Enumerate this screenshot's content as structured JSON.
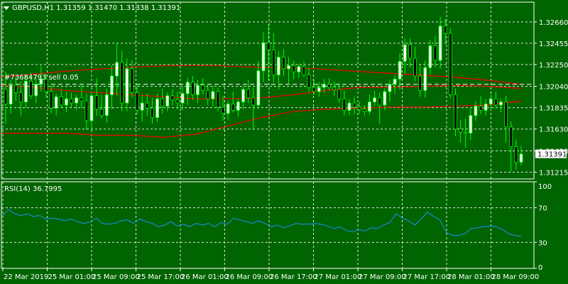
{
  "colors": {
    "background": "#006400",
    "grid": "#ffffff",
    "bull": "#ffffff",
    "bear": "#000000",
    "wick": "#00ff00",
    "ma": "#ff0000",
    "rsi": "#1e90ff",
    "axis_text": "#ffffff",
    "price_label_bg": "#ffffff",
    "price_label_text": "#000000"
  },
  "header": {
    "menu_icon": "triangle-down-icon",
    "text": "GBPUSD,H1  1.31359 1.31470 1.31338 1.31391"
  },
  "order_label": "#73684793 sell 0.05",
  "rsi_header": "RSI(14) 36.7995",
  "chart_data": [
    {
      "type": "candlestick",
      "symbol": "GBPUSD",
      "timeframe": "H1",
      "ylim": [
        1.3115,
        1.3285
      ],
      "y_ticks": [
        "1.32660",
        "1.32455",
        "1.32250",
        "1.32040",
        "1.31835",
        "1.31630",
        "1.31420",
        "1.31215"
      ],
      "current_price": "1.31391",
      "order_level": 1.3206,
      "x_ticks": [
        "22 Mar 2019",
        "25 Mar 01:00",
        "25 Mar 09:00",
        "25 Mar 17:00",
        "26 Mar 01:00",
        "26 Mar 09:00",
        "26 Mar 17:00",
        "27 Mar 01:00",
        "27 Mar 09:00",
        "27 Mar 17:00",
        "28 Mar 01:00",
        "28 Mar 09:00"
      ],
      "candles": [
        {
          "o": 1.3201,
          "h": 1.3218,
          "l": 1.3168,
          "c": 1.3187
        },
        {
          "o": 1.3187,
          "h": 1.321,
          "l": 1.3178,
          "c": 1.3205
        },
        {
          "o": 1.3205,
          "h": 1.3213,
          "l": 1.319,
          "c": 1.3198
        },
        {
          "o": 1.3198,
          "h": 1.3209,
          "l": 1.3176,
          "c": 1.3189
        },
        {
          "o": 1.3189,
          "h": 1.3215,
          "l": 1.3183,
          "c": 1.3209
        },
        {
          "o": 1.3209,
          "h": 1.3217,
          "l": 1.3192,
          "c": 1.3195
        },
        {
          "o": 1.3195,
          "h": 1.3212,
          "l": 1.3188,
          "c": 1.3206
        },
        {
          "o": 1.3206,
          "h": 1.3224,
          "l": 1.3199,
          "c": 1.3211
        },
        {
          "o": 1.3211,
          "h": 1.3216,
          "l": 1.3193,
          "c": 1.3199
        },
        {
          "o": 1.3199,
          "h": 1.3205,
          "l": 1.3178,
          "c": 1.3183
        },
        {
          "o": 1.3183,
          "h": 1.3197,
          "l": 1.3176,
          "c": 1.3194
        },
        {
          "o": 1.3194,
          "h": 1.3201,
          "l": 1.3183,
          "c": 1.3186
        },
        {
          "o": 1.3186,
          "h": 1.3199,
          "l": 1.3179,
          "c": 1.3192
        },
        {
          "o": 1.3192,
          "h": 1.3198,
          "l": 1.3184,
          "c": 1.3188
        },
        {
          "o": 1.3188,
          "h": 1.3196,
          "l": 1.3181,
          "c": 1.3193
        },
        {
          "o": 1.3193,
          "h": 1.3205,
          "l": 1.3183,
          "c": 1.319
        },
        {
          "o": 1.319,
          "h": 1.3197,
          "l": 1.3162,
          "c": 1.3171
        },
        {
          "o": 1.3171,
          "h": 1.3199,
          "l": 1.3162,
          "c": 1.3195
        },
        {
          "o": 1.3195,
          "h": 1.3212,
          "l": 1.3176,
          "c": 1.3182
        },
        {
          "o": 1.3182,
          "h": 1.3196,
          "l": 1.3173,
          "c": 1.3176
        },
        {
          "o": 1.3176,
          "h": 1.3202,
          "l": 1.3169,
          "c": 1.3196
        },
        {
          "o": 1.3196,
          "h": 1.3224,
          "l": 1.3182,
          "c": 1.3214
        },
        {
          "o": 1.3214,
          "h": 1.3246,
          "l": 1.3195,
          "c": 1.3227
        },
        {
          "o": 1.3227,
          "h": 1.3238,
          "l": 1.318,
          "c": 1.3188
        },
        {
          "o": 1.3188,
          "h": 1.3231,
          "l": 1.318,
          "c": 1.3221
        },
        {
          "o": 1.3221,
          "h": 1.3229,
          "l": 1.3193,
          "c": 1.3198
        },
        {
          "o": 1.3198,
          "h": 1.3206,
          "l": 1.3177,
          "c": 1.3181
        },
        {
          "o": 1.3181,
          "h": 1.3196,
          "l": 1.317,
          "c": 1.3188
        },
        {
          "o": 1.3188,
          "h": 1.3197,
          "l": 1.3175,
          "c": 1.3183
        },
        {
          "o": 1.3183,
          "h": 1.3193,
          "l": 1.3168,
          "c": 1.3174
        },
        {
          "o": 1.3174,
          "h": 1.3197,
          "l": 1.317,
          "c": 1.3192
        },
        {
          "o": 1.3192,
          "h": 1.3202,
          "l": 1.3178,
          "c": 1.3185
        },
        {
          "o": 1.3185,
          "h": 1.3198,
          "l": 1.318,
          "c": 1.3195
        },
        {
          "o": 1.3195,
          "h": 1.3201,
          "l": 1.3186,
          "c": 1.3191
        },
        {
          "o": 1.3191,
          "h": 1.3199,
          "l": 1.3182,
          "c": 1.3188
        },
        {
          "o": 1.3188,
          "h": 1.3203,
          "l": 1.3181,
          "c": 1.3197
        },
        {
          "o": 1.3197,
          "h": 1.3212,
          "l": 1.3186,
          "c": 1.3208
        },
        {
          "o": 1.3208,
          "h": 1.3214,
          "l": 1.3191,
          "c": 1.3196
        },
        {
          "o": 1.3196,
          "h": 1.321,
          "l": 1.3188,
          "c": 1.3205
        },
        {
          "o": 1.3205,
          "h": 1.3212,
          "l": 1.3196,
          "c": 1.32
        },
        {
          "o": 1.32,
          "h": 1.3206,
          "l": 1.3186,
          "c": 1.3192
        },
        {
          "o": 1.3192,
          "h": 1.3204,
          "l": 1.3185,
          "c": 1.3199
        },
        {
          "o": 1.3199,
          "h": 1.3203,
          "l": 1.318,
          "c": 1.3184
        },
        {
          "o": 1.3184,
          "h": 1.3195,
          "l": 1.3171,
          "c": 1.3178
        },
        {
          "o": 1.3178,
          "h": 1.319,
          "l": 1.3172,
          "c": 1.3187
        },
        {
          "o": 1.3187,
          "h": 1.3199,
          "l": 1.3179,
          "c": 1.3181
        },
        {
          "o": 1.3181,
          "h": 1.3192,
          "l": 1.3175,
          "c": 1.3189
        },
        {
          "o": 1.3189,
          "h": 1.3204,
          "l": 1.3182,
          "c": 1.3201
        },
        {
          "o": 1.3201,
          "h": 1.321,
          "l": 1.3188,
          "c": 1.3193
        },
        {
          "o": 1.3193,
          "h": 1.3203,
          "l": 1.3162,
          "c": 1.3186
        },
        {
          "o": 1.3186,
          "h": 1.3228,
          "l": 1.3182,
          "c": 1.3219
        },
        {
          "o": 1.3219,
          "h": 1.3256,
          "l": 1.3208,
          "c": 1.3246
        },
        {
          "o": 1.3246,
          "h": 1.3264,
          "l": 1.321,
          "c": 1.3239
        },
        {
          "o": 1.3239,
          "h": 1.3255,
          "l": 1.3208,
          "c": 1.3215
        },
        {
          "o": 1.3215,
          "h": 1.3238,
          "l": 1.3201,
          "c": 1.3232
        },
        {
          "o": 1.3232,
          "h": 1.324,
          "l": 1.3214,
          "c": 1.3221
        },
        {
          "o": 1.3221,
          "h": 1.3232,
          "l": 1.3206,
          "c": 1.3224
        },
        {
          "o": 1.3224,
          "h": 1.3229,
          "l": 1.3211,
          "c": 1.3218
        },
        {
          "o": 1.3218,
          "h": 1.3226,
          "l": 1.3212,
          "c": 1.3223
        },
        {
          "o": 1.3223,
          "h": 1.3228,
          "l": 1.3213,
          "c": 1.3215
        },
        {
          "o": 1.3215,
          "h": 1.3222,
          "l": 1.3198,
          "c": 1.3203
        },
        {
          "o": 1.3203,
          "h": 1.321,
          "l": 1.3196,
          "c": 1.3199
        },
        {
          "o": 1.3199,
          "h": 1.3208,
          "l": 1.3194,
          "c": 1.3203
        },
        {
          "o": 1.3203,
          "h": 1.3211,
          "l": 1.3198,
          "c": 1.3206
        },
        {
          "o": 1.3206,
          "h": 1.3212,
          "l": 1.32,
          "c": 1.3203
        },
        {
          "o": 1.3203,
          "h": 1.3209,
          "l": 1.3195,
          "c": 1.3201
        },
        {
          "o": 1.3201,
          "h": 1.3208,
          "l": 1.3188,
          "c": 1.3192
        },
        {
          "o": 1.3192,
          "h": 1.32,
          "l": 1.3176,
          "c": 1.3181
        },
        {
          "o": 1.3181,
          "h": 1.3192,
          "l": 1.3176,
          "c": 1.3188
        },
        {
          "o": 1.3188,
          "h": 1.3194,
          "l": 1.3177,
          "c": 1.3184
        },
        {
          "o": 1.3184,
          "h": 1.3189,
          "l": 1.3178,
          "c": 1.3182
        },
        {
          "o": 1.3182,
          "h": 1.3186,
          "l": 1.3176,
          "c": 1.318
        },
        {
          "o": 1.318,
          "h": 1.3196,
          "l": 1.3177,
          "c": 1.3189
        },
        {
          "o": 1.3189,
          "h": 1.32,
          "l": 1.3185,
          "c": 1.3193
        },
        {
          "o": 1.3193,
          "h": 1.3198,
          "l": 1.3168,
          "c": 1.3186
        },
        {
          "o": 1.3186,
          "h": 1.3202,
          "l": 1.3181,
          "c": 1.3199
        },
        {
          "o": 1.3199,
          "h": 1.321,
          "l": 1.3189,
          "c": 1.3206
        },
        {
          "o": 1.3206,
          "h": 1.3215,
          "l": 1.3197,
          "c": 1.3211
        },
        {
          "o": 1.3211,
          "h": 1.3236,
          "l": 1.3201,
          "c": 1.3228
        },
        {
          "o": 1.3228,
          "h": 1.325,
          "l": 1.3216,
          "c": 1.3244
        },
        {
          "o": 1.3244,
          "h": 1.325,
          "l": 1.3222,
          "c": 1.3231
        },
        {
          "o": 1.3231,
          "h": 1.3242,
          "l": 1.3209,
          "c": 1.3214
        },
        {
          "o": 1.3214,
          "h": 1.3224,
          "l": 1.3194,
          "c": 1.32
        },
        {
          "o": 1.32,
          "h": 1.3229,
          "l": 1.3193,
          "c": 1.3222
        },
        {
          "o": 1.3222,
          "h": 1.3249,
          "l": 1.3215,
          "c": 1.3243
        },
        {
          "o": 1.3243,
          "h": 1.3252,
          "l": 1.3222,
          "c": 1.3229
        },
        {
          "o": 1.3229,
          "h": 1.3271,
          "l": 1.3221,
          "c": 1.3262
        },
        {
          "o": 1.3262,
          "h": 1.3269,
          "l": 1.3246,
          "c": 1.3255
        },
        {
          "o": 1.3255,
          "h": 1.326,
          "l": 1.3193,
          "c": 1.3196
        },
        {
          "o": 1.3196,
          "h": 1.3202,
          "l": 1.3156,
          "c": 1.3163
        },
        {
          "o": 1.3163,
          "h": 1.3172,
          "l": 1.315,
          "c": 1.316
        },
        {
          "o": 1.316,
          "h": 1.3173,
          "l": 1.3145,
          "c": 1.3159
        },
        {
          "o": 1.3159,
          "h": 1.3184,
          "l": 1.3152,
          "c": 1.3176
        },
        {
          "o": 1.3176,
          "h": 1.319,
          "l": 1.3171,
          "c": 1.3185
        },
        {
          "o": 1.3185,
          "h": 1.3195,
          "l": 1.3177,
          "c": 1.3181
        },
        {
          "o": 1.3181,
          "h": 1.3192,
          "l": 1.3176,
          "c": 1.3187
        },
        {
          "o": 1.3187,
          "h": 1.3196,
          "l": 1.3181,
          "c": 1.3192
        },
        {
          "o": 1.3192,
          "h": 1.3199,
          "l": 1.3183,
          "c": 1.3186
        },
        {
          "o": 1.3186,
          "h": 1.3192,
          "l": 1.3179,
          "c": 1.3189
        },
        {
          "o": 1.3189,
          "h": 1.3195,
          "l": 1.315,
          "c": 1.3165
        },
        {
          "o": 1.3165,
          "h": 1.317,
          "l": 1.3122,
          "c": 1.3146
        },
        {
          "o": 1.3146,
          "h": 1.3153,
          "l": 1.3124,
          "c": 1.3131
        },
        {
          "o": 1.3131,
          "h": 1.3147,
          "l": 1.3128,
          "c": 1.3139
        }
      ],
      "ma_upper": [
        1.3213,
        1.3216,
        1.3219,
        1.3221,
        1.3223,
        1.3224,
        1.3224,
        1.3223,
        1.3222,
        1.3221,
        1.3219,
        1.3217,
        1.3215,
        1.3213,
        1.321,
        1.3206
      ],
      "ma_middle": [
        1.3205,
        1.3203,
        1.32,
        1.3198,
        1.3196,
        1.3194,
        1.3192,
        1.3192,
        1.3193,
        1.3196,
        1.32,
        1.3203,
        1.3203,
        1.3204,
        1.3205,
        1.3204,
        1.3202
      ],
      "ma_lower": [
        1.3159,
        1.3159,
        1.3159,
        1.3157,
        1.3157,
        1.3155,
        1.3158,
        1.3166,
        1.3174,
        1.318,
        1.3182,
        1.3183,
        1.3184,
        1.3184,
        1.3185,
        1.3186,
        1.319
      ]
    },
    {
      "type": "line",
      "title": "RSI(14) 36.7995",
      "ylim": [
        0,
        100
      ],
      "y_ticks": [
        "100",
        "70",
        "30",
        "0"
      ],
      "levels": [
        70,
        30
      ],
      "series": [
        {
          "values": [
            60,
            68,
            63,
            61,
            63,
            60,
            61,
            57,
            58,
            57,
            55,
            57,
            54,
            52,
            53,
            58,
            52,
            51,
            52,
            55,
            56,
            52,
            57,
            54,
            52,
            48,
            50,
            54,
            49,
            51,
            48,
            52,
            50,
            52,
            48,
            53,
            51,
            58,
            56,
            54,
            52,
            55,
            52,
            48,
            50,
            47,
            49,
            52,
            51,
            51,
            52,
            51,
            49,
            46,
            48,
            44,
            42,
            45,
            43,
            47,
            46,
            50,
            53,
            63,
            58,
            55,
            50,
            57,
            65,
            60,
            56,
            42,
            38,
            38,
            40,
            46,
            47,
            48,
            49,
            48,
            45,
            40,
            38,
            36.8
          ]
        }
      ]
    }
  ]
}
